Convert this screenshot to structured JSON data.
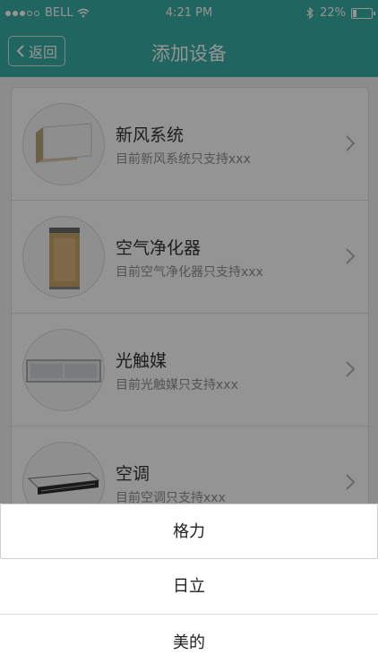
{
  "status": {
    "carrier": "BELL",
    "time": "4:21 PM",
    "battery": "22%",
    "battery_level": 0.22
  },
  "header": {
    "back_label": "返回",
    "title": "添加设备"
  },
  "devices": [
    {
      "name": "新风系统",
      "desc": "目前新风系统只支持xxx",
      "icon": "fresh-air-system-icon"
    },
    {
      "name": "空气净化器",
      "desc": "目前空气净化器只支持xxx",
      "icon": "air-purifier-icon"
    },
    {
      "name": "光触媒",
      "desc": "目前光触媒只支持xxx",
      "icon": "photocatalyst-icon"
    },
    {
      "name": "空调",
      "desc": "目前空调只支持xxx",
      "icon": "air-conditioner-icon"
    }
  ],
  "brand_picker": {
    "options": [
      "格力",
      "日立",
      "美的"
    ],
    "selected": "格力"
  },
  "colors": {
    "accent": "#3aaea6",
    "overlay": "rgba(0,0,0,0.42)"
  }
}
